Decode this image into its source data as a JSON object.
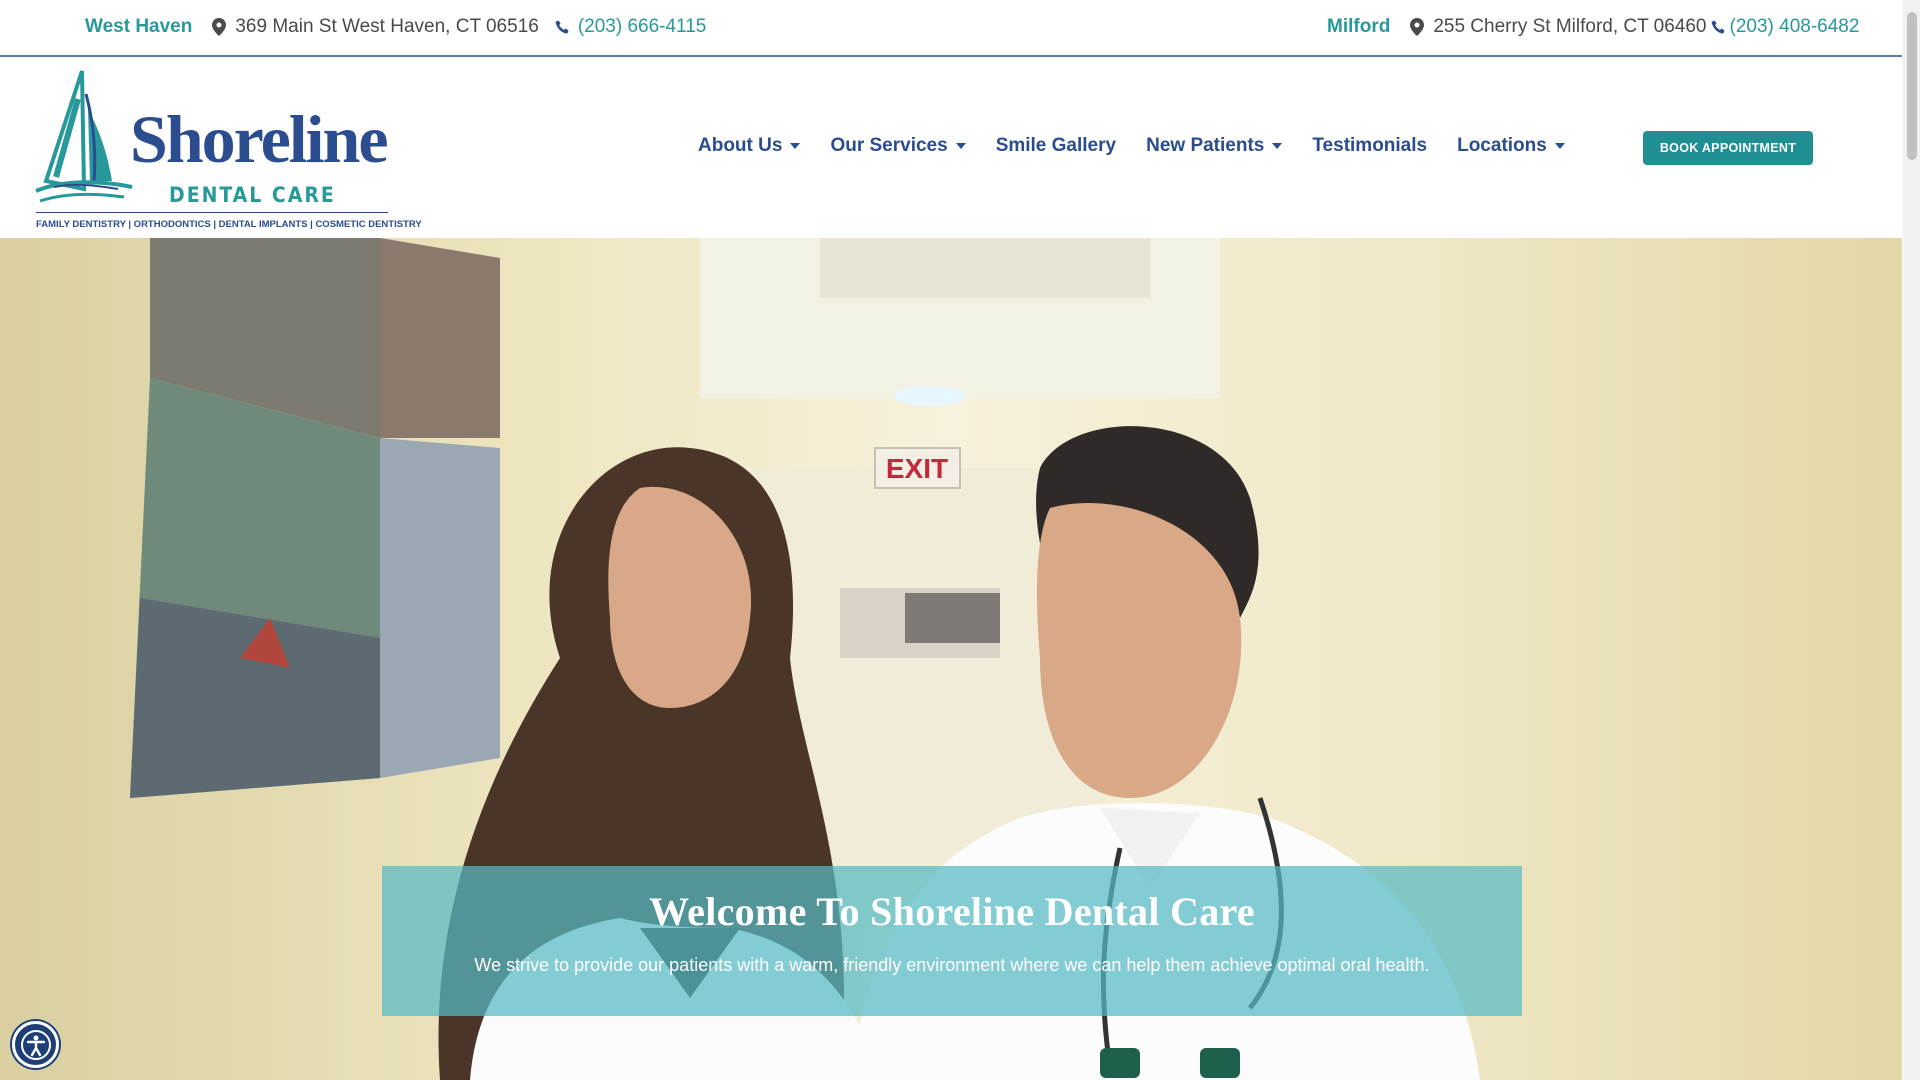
{
  "topbar": {
    "west_haven": {
      "city": "West Haven",
      "address": "369 Main St West Haven, CT 06516",
      "phone": "(203) 666-4115"
    },
    "milford": {
      "city": "Milford",
      "address": "255 Cherry St Milford, CT 06460",
      "phone": "(203) 408-6482"
    }
  },
  "logo": {
    "brand": "Shoreline",
    "sub": "DENTAL CARE",
    "tagline": "FAMILY DENTISTRY | ORTHODONTICS | DENTAL IMPLANTS | COSMETIC DENTISTRY"
  },
  "nav": {
    "about": "About Us",
    "services": "Our Services",
    "gallery": "Smile Gallery",
    "new_patients": "New Patients",
    "testimonials": "Testimonials",
    "locations": "Locations"
  },
  "book_button": "BOOK APPOINTMENT",
  "hero": {
    "title": "Welcome To Shoreline Dental Care",
    "subtitle": "We strive to provide our patients with a warm, friendly environment where we can help them achieve optimal oral health.",
    "exit_sign": "EXIT"
  },
  "colors": {
    "teal": "#27999b",
    "navy": "#2b4c8f",
    "button": "#1f8f93",
    "overlay": "#56bac4"
  },
  "icons": [
    "map-pin-icon",
    "phone-icon",
    "caret-down-icon",
    "sailboat-icon",
    "accessibility-icon"
  ]
}
